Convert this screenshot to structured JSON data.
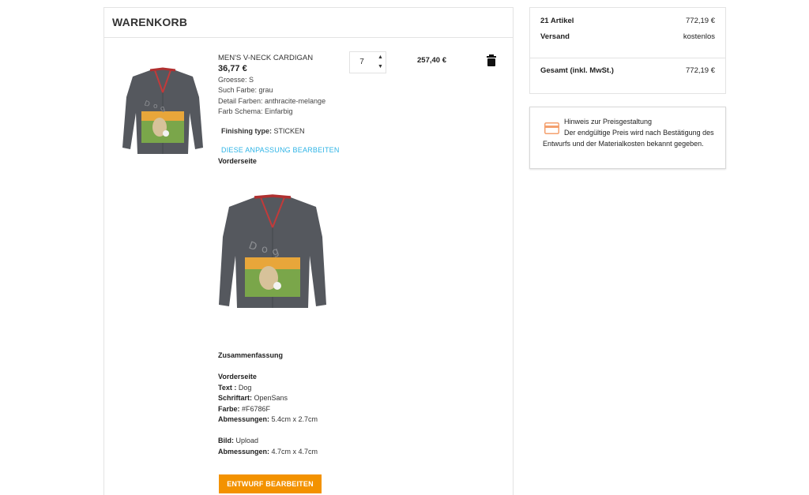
{
  "cart": {
    "title": "WARENKORB",
    "item": {
      "name": "MEN'S V-NECK CARDIGAN",
      "unit_price": "36,77 €",
      "attributes": [
        "Groesse: S",
        "Such Farbe: grau",
        "Detail Farben: anthracite-melange",
        "Farb Schema: Einfarbig"
      ],
      "finishing_label": "Finishing type:",
      "finishing_value": "STICKEN",
      "edit_link": "DIESE ANPASSUNG BEARBEITEN",
      "side_label": "Vorderseite",
      "quantity": "7",
      "line_total": "257,40 €"
    },
    "summary": {
      "heading": "Zusammenfassung",
      "front_heading": "Vorderseite",
      "text_label": "Text :",
      "text_value": "Dog",
      "font_label": "Schriftart:",
      "font_value": "OpenSans",
      "color_label": "Farbe:",
      "color_value": "#F6786F",
      "dims1_label": "Abmessungen:",
      "dims1_value": "5.4cm x 2.7cm",
      "image_label": "Bild:",
      "image_value": "Upload",
      "dims2_label": "Abmessungen:",
      "dims2_value": "4.7cm x 4.7cm"
    },
    "design_button": "ENTWURF BEARBEITEN"
  },
  "totals": {
    "items_label": "21 Artikel",
    "items_value": "772,19 €",
    "shipping_label": "Versand",
    "shipping_value": "kostenlos",
    "total_label": "Gesamt (inkl. MwSt.)",
    "total_value": "772,19 €"
  },
  "notice": {
    "title": "Hinweis zur Preisgestaltung",
    "body": "Der endgültige Preis wird nach Bestätigung des Entwurfs und der Materialkosten bekannt gegeben."
  },
  "icons": {
    "trash": "trash-icon",
    "payment": "credit-card-icon",
    "qty_up": "chevron-up-icon",
    "qty_down": "chevron-down-icon"
  },
  "colors": {
    "accent": "#f39200",
    "link": "#2fb4e6",
    "notice_icon": "#f4a06e"
  }
}
